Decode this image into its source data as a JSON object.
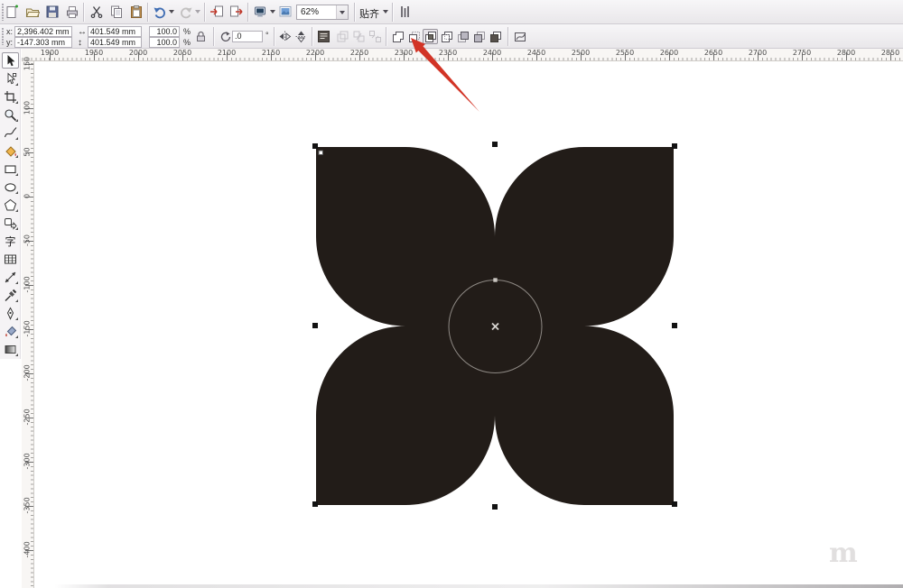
{
  "app": {
    "name": "CorelDRAW drawing window",
    "zoom_level": "62%"
  },
  "standard_toolbar": {
    "zoom_value": "62%",
    "snap_label": "贴齐",
    "buttons": [
      "new",
      "open",
      "save",
      "print",
      "cut",
      "copy",
      "paste",
      "undo",
      "redo",
      "import",
      "export",
      "application-launcher",
      "welcome-screen",
      "zoom-levels",
      "snap-to",
      "options"
    ]
  },
  "property_bar": {
    "position": {
      "x_label": "x:",
      "x_value": "2,396.402 mm",
      "y_label": "y:",
      "y_value": "-147.303 mm"
    },
    "size": {
      "width_icon": "↔",
      "width_value": "401.549 mm",
      "height_icon": "↕",
      "height_value": "401.549 mm"
    },
    "scale": {
      "h_value": "100.0",
      "v_value": "100.0",
      "unit": "%"
    },
    "rotation": {
      "value": ".0",
      "unit": "°"
    },
    "buttons": [
      "mirror-horizontal",
      "mirror-vertical",
      "wrap-text",
      "combine",
      "group",
      "ungroup",
      "weld",
      "trim",
      "intersect",
      "simplify",
      "front-minus-back",
      "back-minus-front",
      "create-boundary",
      "convert-to-curves"
    ],
    "highlighted_button": "intersect"
  },
  "rulers": {
    "unit": "mm",
    "horizontal_labels": [
      "1900",
      "1950",
      "2000",
      "2050",
      "2100",
      "2150",
      "2200",
      "2250",
      "2300",
      "2350",
      "2400",
      "2450",
      "2500",
      "2550",
      "2600",
      "2650",
      "2700",
      "2750",
      "2800",
      "2850"
    ],
    "vertical_labels": [
      "150",
      "100",
      "50",
      "0",
      "-50",
      "-100",
      "-150",
      "-200",
      "-250",
      "-300",
      "-350",
      "-400"
    ]
  },
  "toolbox": {
    "text_glyph": "字",
    "tools": [
      "pick",
      "shape",
      "crop",
      "zoom",
      "freehand",
      "smart-fill",
      "rectangle",
      "ellipse",
      "polygon",
      "basic-shapes",
      "text",
      "table",
      "dimension",
      "eyedropper",
      "outline-pen",
      "fill",
      "interactive-fill"
    ],
    "selected_tool": "pick"
  },
  "canvas": {
    "object": {
      "type": "four-petal-flower",
      "fill": "#221c18",
      "handle_color": "#121212"
    },
    "overlay_circle": {
      "stroke": "#8e8984"
    },
    "center_marker_color": "#d8d5d1"
  },
  "annotation": {
    "arrow_color": "#d23426",
    "points_to": "intersect-button"
  },
  "watermark": {
    "text": "m"
  }
}
